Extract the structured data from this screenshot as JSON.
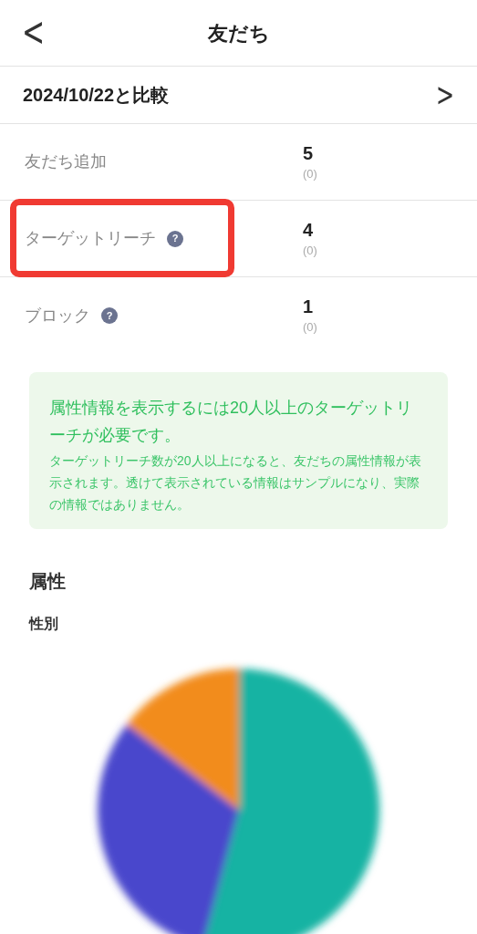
{
  "header": {
    "back": "<",
    "title": "友だち"
  },
  "compare": {
    "label": "2024/10/22と比較",
    "chevron": ">"
  },
  "stats": [
    {
      "label": "友だち追加",
      "highlighted": false,
      "value": "5",
      "diff": "(0)"
    },
    {
      "label": "ターゲットリーチ",
      "help": "?",
      "highlighted": true,
      "value": "4",
      "diff": "(0)"
    },
    {
      "label": "ブロック",
      "help": "?",
      "highlighted": false,
      "value": "1",
      "diff": "(0)"
    }
  ],
  "notice": {
    "title": "属性情報を表示するには20人以上のターゲットリーチが必要です。",
    "body": "ターゲットリーチ数が20人以上になると、友だちの属性情報が表示されます。透けて表示されている情報はサンプルになり、実際の情報ではありません。"
  },
  "attributes": {
    "heading": "属性",
    "subheading": "性別"
  }
}
